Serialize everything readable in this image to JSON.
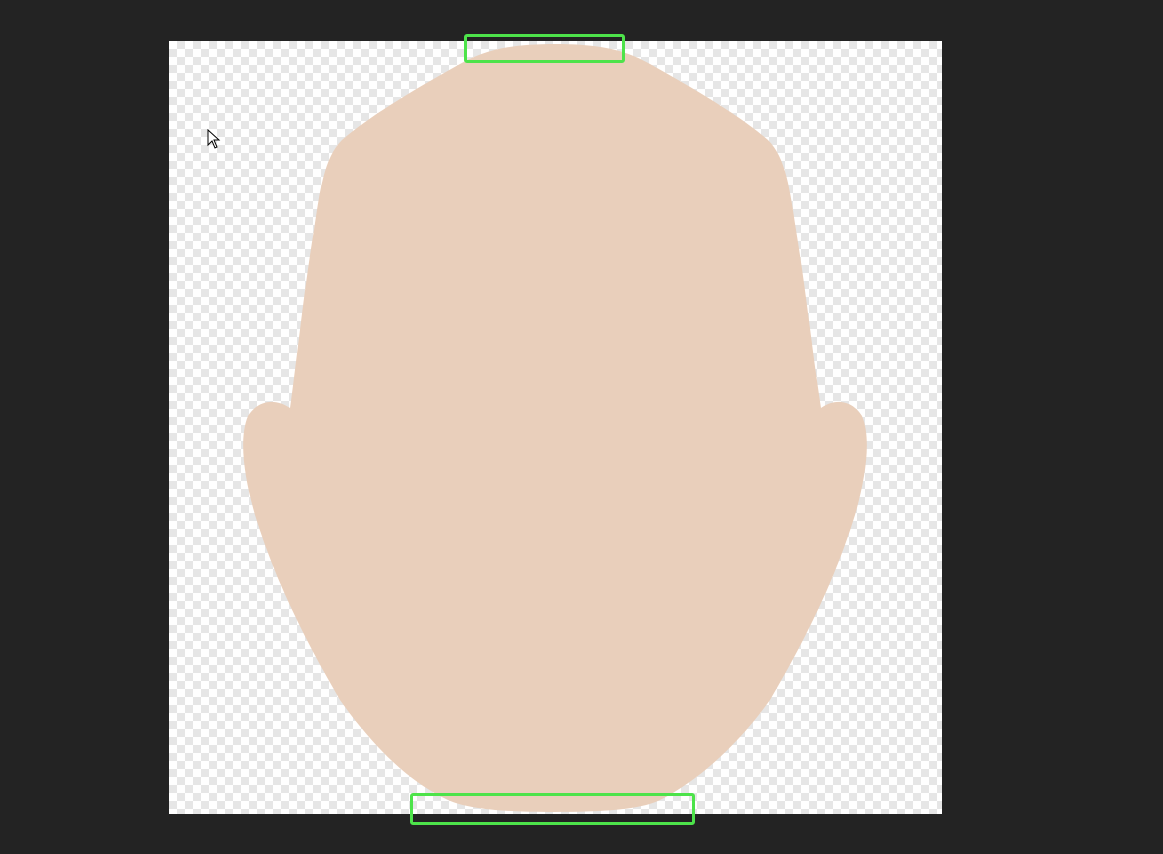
{
  "canvas": {
    "background": "transparent-checkerboard",
    "checker_color": "#e6e6e6"
  },
  "workspace": {
    "background_color": "#232323"
  },
  "head_shape": {
    "fill_color": "#e9cfbb"
  },
  "highlights": {
    "color": "#4de34a",
    "items": [
      "top-of-head",
      "chin"
    ]
  },
  "cursor": {
    "icon": "arrow-pointer-icon"
  }
}
